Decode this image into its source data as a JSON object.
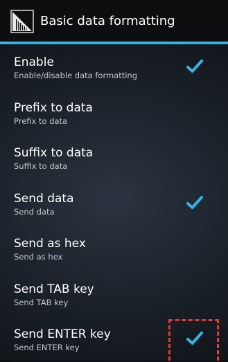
{
  "action_bar": {
    "title": "Basic data formatting",
    "icon": "barcode-scanner-app-icon",
    "accent_color": "#33b5e5"
  },
  "settings": [
    {
      "label": "Enable",
      "summary": "Enable/disable data formatting",
      "checked": true
    },
    {
      "label": "Prefix to data",
      "summary": "Prefix to data",
      "checked": false
    },
    {
      "label": "Suffix to data",
      "summary": "Suffix to data",
      "checked": false
    },
    {
      "label": "Send data",
      "summary": "Send data",
      "checked": true
    },
    {
      "label": "Send as hex",
      "summary": "Send as hex",
      "checked": false
    },
    {
      "label": "Send TAB key",
      "summary": "Send TAB key",
      "checked": false
    },
    {
      "label": "Send ENTER key",
      "summary": "Send ENTER key",
      "checked": true
    }
  ],
  "highlight_color": "#e03a3a",
  "check_color": "#33b5e5"
}
